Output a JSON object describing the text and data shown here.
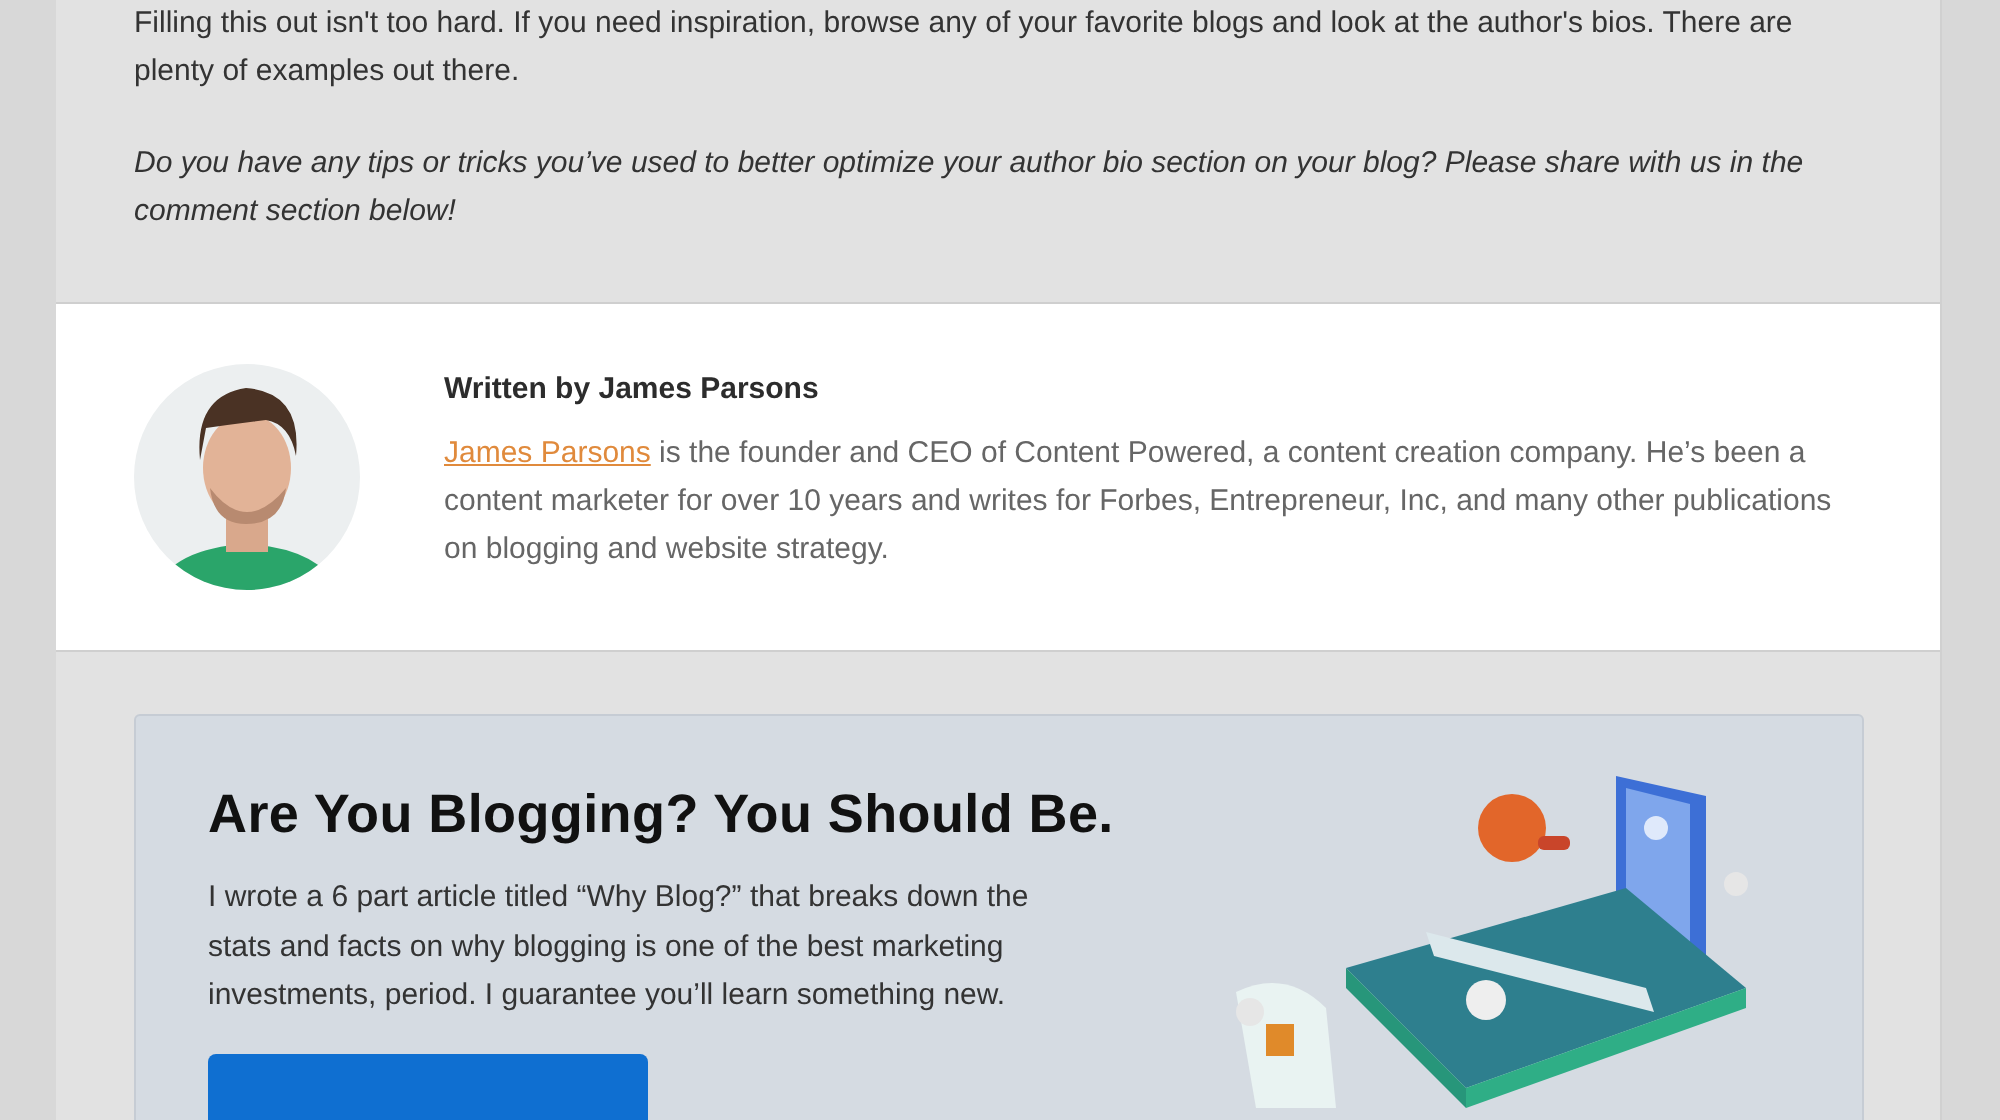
{
  "article": {
    "paragraphs": [
      {
        "text": "Filling this out isn't too hard. If you need inspiration, browse any of your favorite blogs and look at the author's bios. There are plenty of examples out there.",
        "italic": false
      },
      {
        "text": "Do you have any tips or tricks you’ve used to better optimize your author bio section on your blog? Please share with us in the comment section below!",
        "italic": true
      }
    ]
  },
  "author_box": {
    "heading": "Written by James Parsons",
    "link": "James Parsons",
    "bio": " is the founder and CEO of Content Powered, a content creation company. He’s been a content marketer for over 10 years and writes for Forbes, Entrepreneur, Inc, and many other publications on blogging and website strategy."
  },
  "promo": {
    "title": "Are You Blogging? You Should Be.",
    "text": "I wrote a 6 part article titled “Why Blog?” that breaks down the stats and facts on why blogging is one of the best marketing investments, period. I guarantee you’ll learn something new."
  }
}
